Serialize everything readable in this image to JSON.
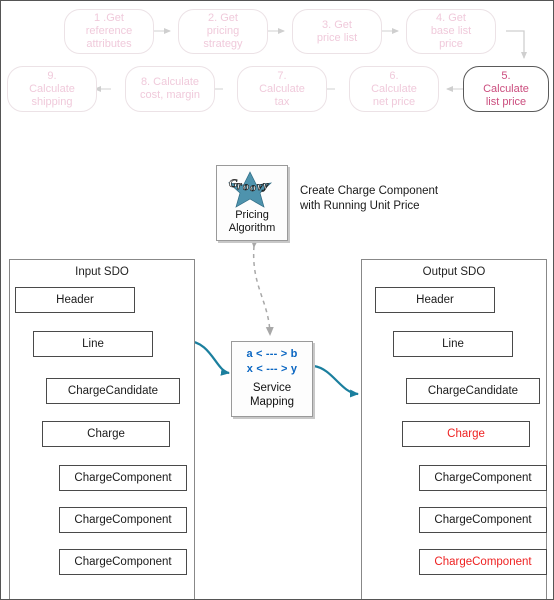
{
  "diagram": {
    "title": "Pricing Algorithm Service Mapping Diagram",
    "colors": {
      "faded_pink": "#f0cadb",
      "active_pink": "#cb4d7e",
      "red_highlight": "#ee2222",
      "mapping_blue": "#0a66c2",
      "teal_arrow": "#1b7f9e",
      "gray_connector": "#9a9a9a",
      "groovy_star": "#4e93ad"
    }
  },
  "flow_steps": [
    {
      "label": "1 .Get\nreference\nattributes",
      "active": false
    },
    {
      "label": "2. Get\npricing\nstrategy",
      "active": false
    },
    {
      "label": "3. Get\nprice list",
      "active": false
    },
    {
      "label": "4. Get\nbase list\nprice",
      "active": false
    },
    {
      "label": "5.\nCalculate\nlist price",
      "active": true
    },
    {
      "label": "6.\nCalculate\nnet price",
      "active": false
    },
    {
      "label": "7.\nCalculate\ntax",
      "active": false
    },
    {
      "label": "8. Calculate\ncost, margin",
      "active": false
    },
    {
      "label": "9.\nCalculate\nshipping",
      "active": false
    }
  ],
  "algorithm": {
    "logo_name": "groovy-logo",
    "label": "Pricing\nAlgorithm",
    "caption": "Create Charge  Component\nwith Running Unit Price"
  },
  "service_mapping": {
    "mapping_lines": [
      "a < --- > b",
      "x < --- > y"
    ],
    "label": "Service\nMapping"
  },
  "input_sdo": {
    "title": "Input SDO",
    "nodes": [
      {
        "label": "Header",
        "red": false
      },
      {
        "label": "Line",
        "red": false
      },
      {
        "label": "ChargeCandidate",
        "red": false
      },
      {
        "label": "Charge",
        "red": false
      },
      {
        "label": "ChargeComponent",
        "red": false
      },
      {
        "label": "ChargeComponent",
        "red": false
      },
      {
        "label": "ChargeComponent",
        "red": false
      }
    ]
  },
  "output_sdo": {
    "title": "Output SDO",
    "nodes": [
      {
        "label": "Header",
        "red": false
      },
      {
        "label": "Line",
        "red": false
      },
      {
        "label": "ChargeCandidate",
        "red": false
      },
      {
        "label": "Charge",
        "red": true
      },
      {
        "label": "ChargeComponent",
        "red": false
      },
      {
        "label": "ChargeComponent",
        "red": false
      },
      {
        "label": "ChargeComponent",
        "red": true
      }
    ]
  }
}
